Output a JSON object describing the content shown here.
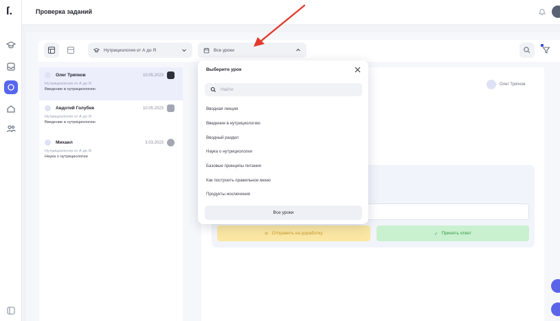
{
  "header": {
    "title": "Проверка заданий"
  },
  "toolbar": {
    "course_select": "Нутрициология от А до Я",
    "lesson_select": "Все уроки"
  },
  "list": {
    "items": [
      {
        "name": "Олег Тряпков",
        "date": "10.05.2023",
        "course": "Нутрициология от А до Я",
        "lesson": "Введение в нутрициологию",
        "selected": true
      },
      {
        "name": "Авдотий Голубев",
        "date": "10.05.2023",
        "course": "Нутрициология от А до Я",
        "lesson": "Введение в нутрициологию",
        "selected": false
      },
      {
        "name": "Михаил",
        "date": "3.03.2023",
        "course": "Нутрициология от А до Я",
        "lesson": "Наука о нутрициологии",
        "selected": false
      }
    ]
  },
  "detail": {
    "user_name": "Олег Тряпков",
    "reject_label": "Отправить на доработку",
    "accept_label": "Принять ответ"
  },
  "dropdown": {
    "title": "Выберите урок",
    "search_placeholder": "Найти",
    "options": [
      "Вводная лекция",
      "Введение в нутрициологию",
      "Вводный раздел",
      "Наука о нутрициологии",
      "Базовые принципы питания",
      "Как построить правильное меню",
      "Продукты исключения"
    ],
    "all_label": "Все уроки"
  },
  "colors": {
    "accent": "#5666f0",
    "arrow": "#e23b2e",
    "warn_bg": "#fbe7a3",
    "ok_bg": "#c9f0cf"
  }
}
